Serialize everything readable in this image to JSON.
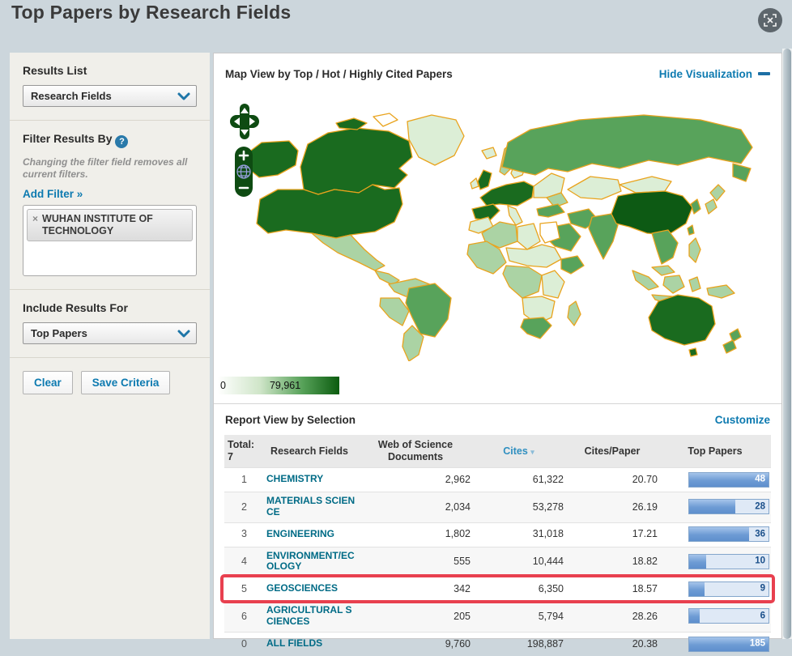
{
  "page": {
    "title": "Top Papers by Research Fields"
  },
  "sidebar": {
    "results_list": {
      "label": "Results List",
      "selected": "Research Fields"
    },
    "filter": {
      "label": "Filter Results By",
      "help_icon": "?",
      "note": "Changing the filter field removes all current filters.",
      "add_filter_label": "Add Filter »",
      "chips": [
        {
          "remove": "×",
          "label": "WUHAN INSTITUTE OF TECHNOLOGY"
        }
      ]
    },
    "include_results": {
      "label": "Include Results For",
      "selected": "Top Papers"
    },
    "buttons": {
      "clear": "Clear",
      "save": "Save Criteria"
    }
  },
  "map": {
    "title": "Map View by Top / Hot / Highly Cited Papers",
    "hide_link": "Hide Visualization",
    "legend": {
      "min": "0",
      "max": "79,961"
    },
    "controls": [
      "pan-up",
      "pan-down",
      "pan-left",
      "pan-right",
      "zoom-in",
      "globe",
      "zoom-out"
    ]
  },
  "report": {
    "title": "Report View by Selection",
    "customize_link": "Customize",
    "total_label": "Total:",
    "total_value": "7",
    "columns": {
      "field": "Research Fields",
      "docs": "Web of Science Documents",
      "cites": "Cites",
      "sort_caret": "▾",
      "cites_per_paper": "Cites/Paper",
      "top_papers": "Top Papers"
    },
    "rows": [
      {
        "rank": "1",
        "field": "CHEMISTRY",
        "docs": "2,962",
        "cites": "61,322",
        "cpp": "20.70",
        "top": "48",
        "bar_pct": 100,
        "highlight": false
      },
      {
        "rank": "2",
        "field": "MATERIALS SCIENCE",
        "docs": "2,034",
        "cites": "53,278",
        "cpp": "26.19",
        "top": "28",
        "bar_pct": 58,
        "highlight": false
      },
      {
        "rank": "3",
        "field": "ENGINEERING",
        "docs": "1,802",
        "cites": "31,018",
        "cpp": "17.21",
        "top": "36",
        "bar_pct": 75,
        "highlight": false
      },
      {
        "rank": "4",
        "field": "ENVIRONMENT/ECOLOGY",
        "docs": "555",
        "cites": "10,444",
        "cpp": "18.82",
        "top": "10",
        "bar_pct": 21,
        "highlight": false
      },
      {
        "rank": "5",
        "field": "GEOSCIENCES",
        "docs": "342",
        "cites": "6,350",
        "cpp": "18.57",
        "top": "9",
        "bar_pct": 19,
        "highlight": true
      },
      {
        "rank": "6",
        "field": "AGRICULTURAL SCIENCES",
        "docs": "205",
        "cites": "5,794",
        "cpp": "28.26",
        "top": "6",
        "bar_pct": 13,
        "highlight": false
      },
      {
        "rank": "0",
        "field": "ALL FIELDS",
        "docs": "9,760",
        "cites": "198,887",
        "cpp": "20.38",
        "top": "185",
        "bar_pct": 100,
        "highlight": false
      }
    ]
  },
  "colors": {
    "accent_link": "#0d7ab0",
    "field_link": "#006b86",
    "highlight_ring": "#e8404f",
    "bar_fill": "#6d9bd4",
    "bar_background": "#dfe9f6",
    "legend_min_color": "#ffffff",
    "legend_max_color": "#0c5c10",
    "map_country_border": "#e9a31d",
    "map_dark_green": "#1a6b1f",
    "map_medium_green": "#58a35b",
    "sidebar_background": "#f0efea",
    "page_background": "#ccd6dc"
  }
}
